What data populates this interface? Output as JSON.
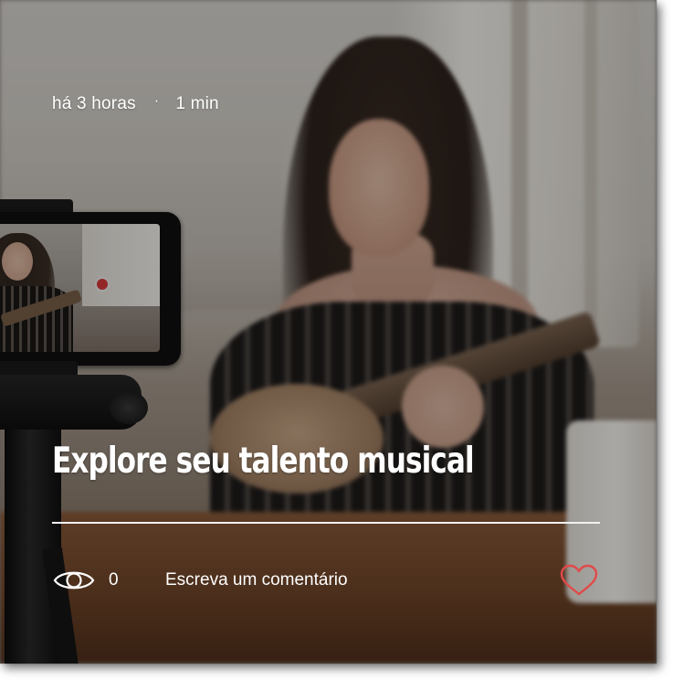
{
  "post": {
    "time_ago": "há 3 horas",
    "separator": "·",
    "read_time": "1 min",
    "title": "Explore seu talento musical",
    "views_count": "0",
    "comment_prompt": "Escreva um comentário"
  },
  "icons": {
    "views": "eye-icon",
    "like": "heart-outline-icon"
  },
  "colors": {
    "text": "#ffffff",
    "divider": "#f2f2f2",
    "like_heart": "#e04a4a"
  }
}
